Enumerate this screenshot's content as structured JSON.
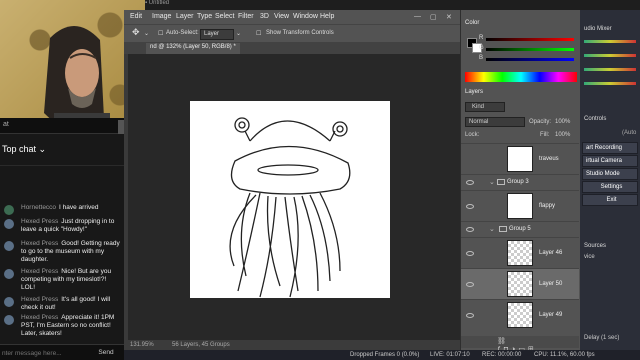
{
  "photoshop": {
    "title": "Untitled",
    "menu": [
      "Edit",
      "Image",
      "Layer",
      "Type",
      "Select",
      "Filter",
      "3D",
      "View",
      "Window",
      "Help"
    ],
    "options": {
      "auto_select_label": "Auto-Select:",
      "auto_select_value": "Layer",
      "transform_controls_label": "Show Transform Controls"
    },
    "doc_tab": "nd @ 132% (Layer 50, RGB/8) *",
    "status": {
      "zoom": "131.95%",
      "info": "56 Layers, 45 Groups"
    }
  },
  "color_panel": {
    "tab": "Color"
  },
  "layers_panel": {
    "tab": "Layers",
    "filter_kind": "Kind",
    "blend_mode": "Normal",
    "opacity_label": "Opacity:",
    "opacity_value": "100%",
    "lock_label": "Lock:",
    "fill_label": "Fill:",
    "fill_value": "100%",
    "rows": [
      {
        "type": "layer",
        "name": "traveus"
      },
      {
        "type": "group",
        "name": "Group 3"
      },
      {
        "type": "layer",
        "name": "flappy"
      },
      {
        "type": "group",
        "name": "Group 5"
      },
      {
        "type": "layer",
        "name": "Layer 46"
      },
      {
        "type": "layer",
        "name": "Layer 50",
        "selected": true
      },
      {
        "type": "layer",
        "name": "Layer 49"
      }
    ]
  },
  "chat": {
    "top_label": "at",
    "header": "Top chat",
    "messages": [
      {
        "author": "Hornettecco",
        "text": "I have arrived"
      },
      {
        "author": "Hexed Press",
        "text": "Just dropping in to leave a quick \"Howdy!\""
      },
      {
        "author": "Hexed Press",
        "text": "Good! Getting ready to go to the museum with my daughter."
      },
      {
        "author": "Hexed Press",
        "text": "Nice! But are you competing with my timeslot!?! LOL!"
      },
      {
        "author": "Hexed Press",
        "text": "It's all good! I will check it out!"
      },
      {
        "author": "Hexed Press",
        "text": "Appreciate it! 1PM PST, I'm Eastern so no conflict! Later, skaters!"
      }
    ],
    "input_placeholder": "nter message here...",
    "send_label": "Send"
  },
  "obs": {
    "mixer_label": "udio Mixer",
    "controls_label": "Controls",
    "auto_label": "(Auto",
    "buttons": [
      "art Recording",
      "irtual Camera",
      "Studio Mode",
      "Settings",
      "Exit"
    ],
    "sources_label": "Sources",
    "device_label": "vice",
    "delay_label": "Delay (1 sec)"
  },
  "status_bar": {
    "dropped": "Dropped Frames 0 (0.0%)",
    "live": "LIVE: 01:07:10",
    "rec": "REC: 00:00:00",
    "cpu": "CPU: 11.1%, 60.00 fps"
  }
}
